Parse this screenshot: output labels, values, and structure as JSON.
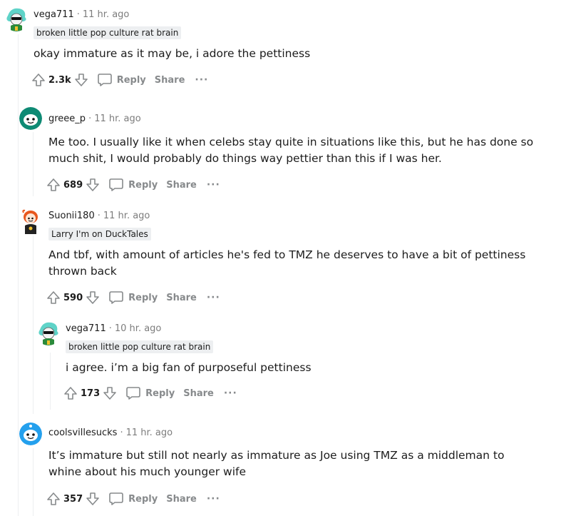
{
  "actions": {
    "reply": "Reply",
    "share": "Share",
    "more": "···"
  },
  "comments": [
    {
      "user": "vega711",
      "sep": "·",
      "time": "11 hr. ago",
      "flair": "broken little pop culture rat brain",
      "body": "okay immature as it may be, i adore the pettiness",
      "score": "2.3k"
    },
    {
      "user": "greee_p",
      "sep": "·",
      "time": "11 hr. ago",
      "body": "Me too. I usually like it when celebs stay quite in situations like this, but he has done so much shit, I would probably do things way pettier than this if I was her.",
      "score": "689"
    },
    {
      "user": "Suonii180",
      "sep": "·",
      "time": "11 hr. ago",
      "flair": "Larry I'm on DuckTales",
      "body": "And tbf, with amount of articles he's fed to TMZ he deserves to have a bit of pettiness thrown back",
      "score": "590"
    },
    {
      "user": "vega711",
      "sep": "·",
      "time": "10 hr. ago",
      "flair": "broken little pop culture rat brain",
      "body": "i agree. i’m a big fan of purposeful pettiness",
      "score": "173"
    },
    {
      "user": "coolsvillesucks",
      "sep": "·",
      "time": "11 hr. ago",
      "body": "It’s immature but still not nearly as immature as Joe using TMZ as a middleman to whine about his much younger wife",
      "score": "357"
    }
  ]
}
